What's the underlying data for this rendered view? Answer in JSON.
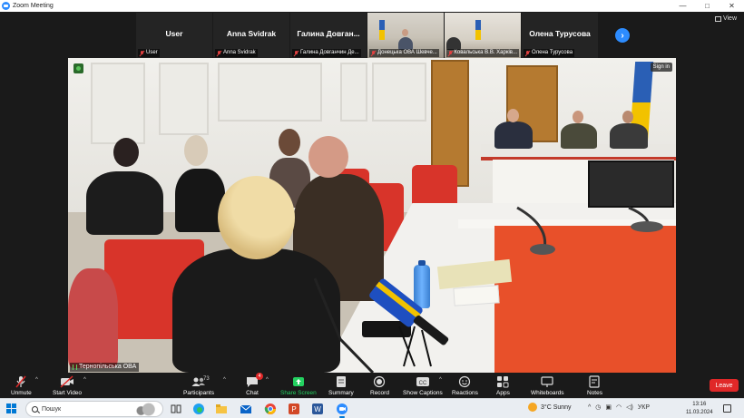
{
  "window": {
    "title": "Zoom Meeting",
    "controls": [
      "—",
      "□",
      "✕"
    ]
  },
  "thumbnails": [
    {
      "big_name": "User",
      "label": "User",
      "kind": "avatar"
    },
    {
      "big_name": "Anna Svidrak",
      "label": "Anna Svidrak",
      "kind": "avatar"
    },
    {
      "big_name": "Галина  Довган...",
      "label": "Галина Довганчин Де...",
      "kind": "avatar"
    },
    {
      "big_name": "",
      "label": "Донецька ОВА Шевче...",
      "kind": "video"
    },
    {
      "big_name": "",
      "label": "Ковальська В.В. Харків...",
      "kind": "video"
    },
    {
      "big_name": "Олена Турусова",
      "label": "Олена Турусова",
      "kind": "avatar"
    }
  ],
  "view_button": "View",
  "speaker": {
    "name": "Тернопільська ОВА",
    "sign_in": "Sign in"
  },
  "toolbar": {
    "unmute": "Unmute",
    "start_video": "Start Video",
    "participants": "Participants",
    "participants_count": "73",
    "chat": "Chat",
    "chat_badge": "4",
    "share_screen": "Share Screen",
    "summary": "Summary",
    "record": "Record",
    "show_captions": "Show Captions",
    "reactions": "Reactions",
    "apps": "Apps",
    "whiteboards": "Whiteboards",
    "notes": "Notes",
    "leave": "Leave"
  },
  "taskbar": {
    "search_placeholder": "Пошук",
    "weather": "3°C  Sunny",
    "language": "УКР",
    "time": "13:16",
    "date": "11.03.2024"
  },
  "colors": {
    "zoom_blue": "#2d8cff",
    "leave_red": "#e02828",
    "share_green": "#23d160"
  }
}
